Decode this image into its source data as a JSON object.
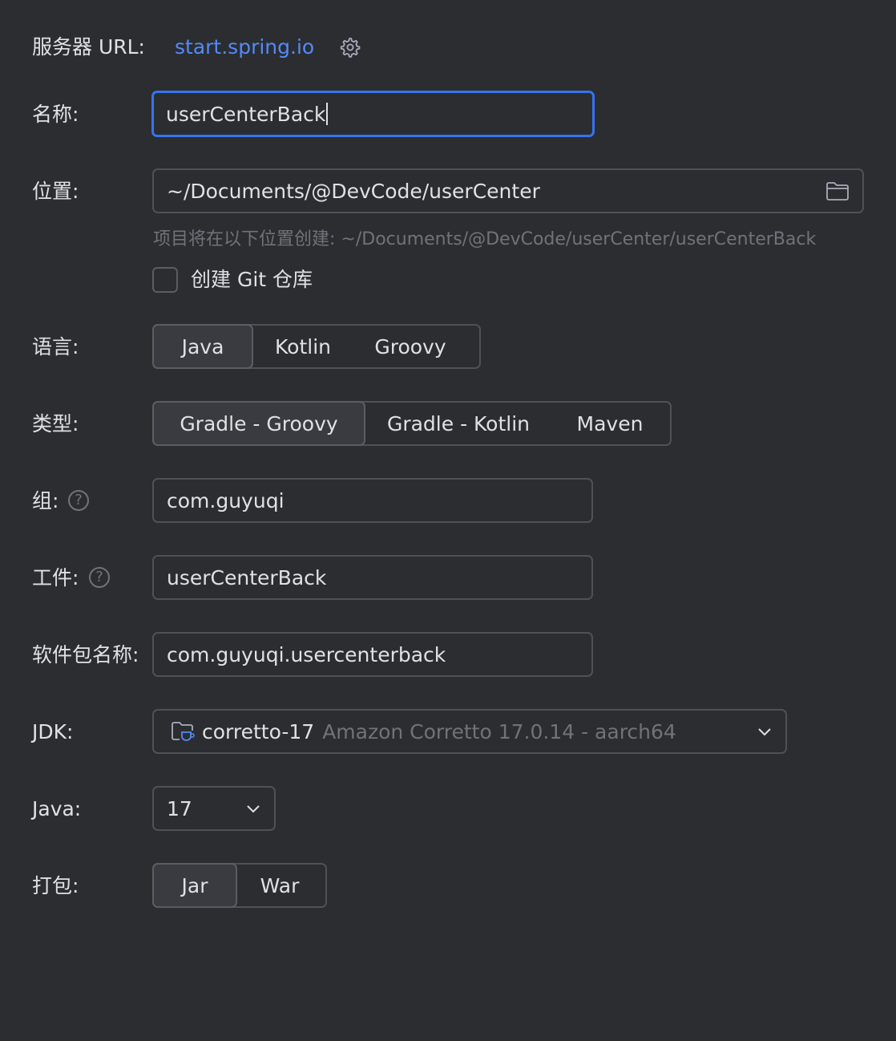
{
  "server": {
    "label": "服务器 URL:",
    "url": "start.spring.io",
    "settings_icon": "gear-icon"
  },
  "name": {
    "label": "名称:",
    "value": "userCenterBack"
  },
  "location": {
    "label": "位置:",
    "value": "~/Documents/@DevCode/userCenter",
    "folder_icon": "folder-icon",
    "hint": "项目将在以下位置创建: ~/Documents/@DevCode/userCenter/userCenterBack"
  },
  "git": {
    "label": "创建 Git 仓库",
    "checked": false
  },
  "language": {
    "label": "语言:",
    "options": [
      "Java",
      "Kotlin",
      "Groovy"
    ],
    "selected": "Java"
  },
  "type": {
    "label": "类型:",
    "options": [
      "Gradle - Groovy",
      "Gradle - Kotlin",
      "Maven"
    ],
    "selected": "Gradle - Groovy"
  },
  "group": {
    "label": "组:",
    "value": "com.guyuqi",
    "help": "?"
  },
  "artifact": {
    "label": "工件:",
    "value": "userCenterBack",
    "help": "?"
  },
  "package": {
    "label": "软件包名称:",
    "value": "com.guyuqi.usercenterback"
  },
  "jdk": {
    "label": "JDK:",
    "name": "corretto-17",
    "detail": "Amazon Corretto 17.0.14 - aarch64"
  },
  "java": {
    "label": "Java:",
    "value": "17"
  },
  "packaging": {
    "label": "打包:",
    "options": [
      "Jar",
      "War"
    ],
    "selected": "Jar"
  },
  "colors": {
    "background": "#2b2d30",
    "accent": "#3574f0",
    "link": "#548af7"
  }
}
